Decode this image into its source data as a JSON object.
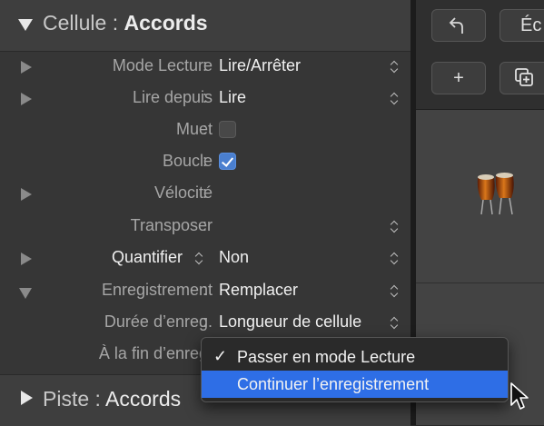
{
  "cell_header": {
    "label": "Cellule :",
    "value": "Accords"
  },
  "rows": [
    {
      "label": "Mode Lecture",
      "value": "Lire/Arrêter"
    },
    {
      "label": "Lire depuis",
      "value": "Lire"
    },
    {
      "label": "Muet",
      "checked": false
    },
    {
      "label": "Boucle",
      "checked": true
    },
    {
      "label": "Vélocité",
      "value": ""
    },
    {
      "label": "Transposer",
      "value": ""
    },
    {
      "label": "Quantifier",
      "value": "Non"
    },
    {
      "label": "Enregistrement",
      "value": "Remplacer"
    },
    {
      "label": "Durée d’enreg.",
      "value": "Longueur de cellule"
    },
    {
      "label": "À la fin d’enreg.",
      "value": ""
    }
  ],
  "colon": ":",
  "piste_header": {
    "label": "Piste :",
    "value": "Accords"
  },
  "toolbar": {
    "back_icon": "↰",
    "ec_label": "Éc",
    "add_icon": "+",
    "dup_icon": "⧉"
  },
  "popup_menu": {
    "items": [
      {
        "label": "Passer en mode Lecture",
        "checked": true,
        "mark": "✓"
      },
      {
        "label": "Continuer l’enregistrement",
        "checked": false,
        "highlighted": true
      }
    ]
  },
  "icons": {
    "congas": "congas-instrument-icon",
    "cursor": "arrow-cursor-icon"
  },
  "colors": {
    "accent": "#2e6ee6",
    "checkbox_checked": "#4a7fcf",
    "panel": "#363636"
  }
}
